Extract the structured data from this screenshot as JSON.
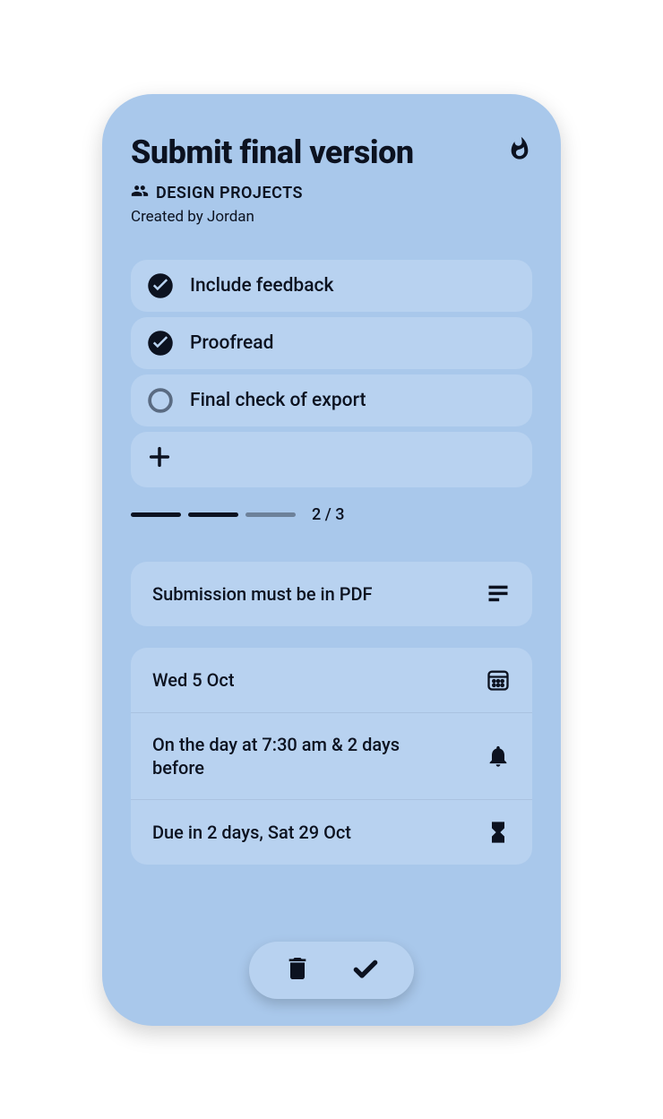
{
  "header": {
    "title": "Submit final version",
    "project": "DESIGN PROJECTS",
    "created_by": "Created by Jordan"
  },
  "subtasks": [
    {
      "label": "Include feedback",
      "done": true
    },
    {
      "label": "Proofread",
      "done": true
    },
    {
      "label": "Final check of export",
      "done": false
    }
  ],
  "progress": {
    "done": 2,
    "total": 3,
    "text": "2 / 3"
  },
  "note": "Submission must be in PDF",
  "date": "Wed 5 Oct",
  "reminder": "On the day at 7:30 am & 2 days before",
  "due": "Due in 2 days, Sat 29 Oct"
}
